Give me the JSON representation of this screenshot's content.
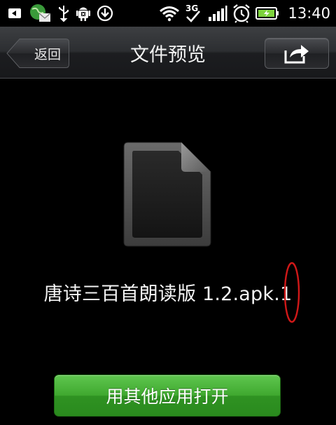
{
  "status_bar": {
    "time": "13:40",
    "network": "3G",
    "icons": [
      "back-arrow-icon",
      "mail-globe-icon",
      "usb-icon",
      "android-debug-icon",
      "download-icon",
      "wifi-icon",
      "3g-data-icon",
      "signal-icon",
      "alarm-icon",
      "battery-charging-icon"
    ]
  },
  "titlebar": {
    "back_label": "返回",
    "title": "文件预览",
    "share_icon": "share-export-icon"
  },
  "content": {
    "file_icon": "document-icon",
    "file_name": "唐诗三百首朗读版 1.2.apk.1"
  },
  "actions": {
    "open_label": "用其他应用打开"
  },
  "colors": {
    "background": "#000000",
    "titlebar": "#2c2e31",
    "button_green": "#3fa82f",
    "annotation_red": "#d01818"
  }
}
